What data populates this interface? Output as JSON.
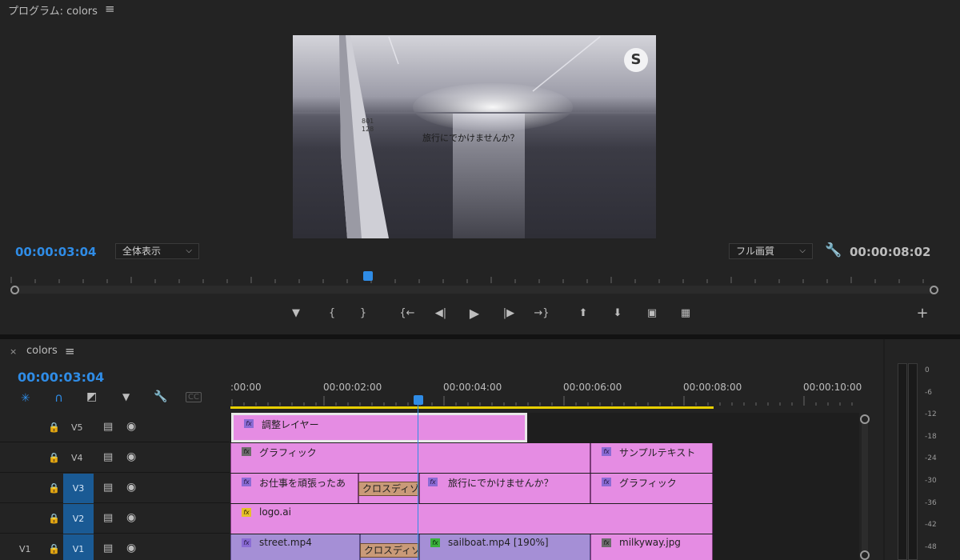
{
  "program": {
    "title": "プログラム: colors",
    "video_caption": "旅行にでかけませんか？",
    "logo_letter": "S",
    "current_timecode": "00:00:03:04",
    "zoom_select": "全体表示",
    "quality_select": "フル画質",
    "duration_timecode": "00:00:08:02",
    "controls": [
      "marker-icon",
      "mark-in-icon",
      "mark-out-icon",
      "go-to-in-icon",
      "step-back-icon",
      "play-icon",
      "step-forward-icon",
      "go-to-out-icon",
      "lift-icon",
      "extract-icon",
      "camera-icon",
      "compare-icon"
    ],
    "add_icon": "plus-icon",
    "playhead_fraction": 0.382
  },
  "timeline": {
    "close_glyph": "×",
    "sequence_name": "colors",
    "current_timecode": "00:00:03:04",
    "tool_icons": [
      "snap-icon",
      "magnet-icon",
      "linked-selection-icon",
      "add-marker-icon",
      "wrench-icon",
      "captions-icon"
    ],
    "ruler_labels": [
      ":00:00",
      "00:00:02:00",
      "00:00:04:00",
      "00:00:06:00",
      "00:00:08:00",
      "00:00:10:00"
    ],
    "tracks": [
      {
        "id": "V5",
        "targeted": false,
        "source": ""
      },
      {
        "id": "V4",
        "targeted": false,
        "source": ""
      },
      {
        "id": "V3",
        "targeted": true,
        "source": ""
      },
      {
        "id": "V2",
        "targeted": true,
        "source": ""
      },
      {
        "id": "V1",
        "targeted": true,
        "source": "V1"
      }
    ],
    "clips": {
      "v5_adjust": "調整レイヤー",
      "v4_graphic": "グラフィック",
      "v4_sample_text": "サンプルテキスト",
      "v3_work": "お仕事を頑張ったあ",
      "v3_transition": "クロスディゾ",
      "v3_travel": "旅行にでかけませんか？",
      "v3_graphic": "グラフィック",
      "v2_logo": "logo.ai",
      "v1_street": "street.mp4",
      "v1_transition": "クロスディゾ",
      "v1_sailboat": "sailboat.mp4 [190%]",
      "v1_milkyway": "milkyway.jpg"
    },
    "fx_label": "fx"
  },
  "meter": {
    "scale": [
      "0",
      "-6",
      "-12",
      "-18",
      "-24",
      "-30",
      "-36",
      "-42",
      "-48"
    ]
  },
  "colors": {
    "accent_blue": "#2f8ce6",
    "clip_pink": "#e58ce3",
    "clip_purple": "#a58fd6",
    "work_area_yellow": "#e8d000",
    "target_blue": "#1a5a94"
  }
}
